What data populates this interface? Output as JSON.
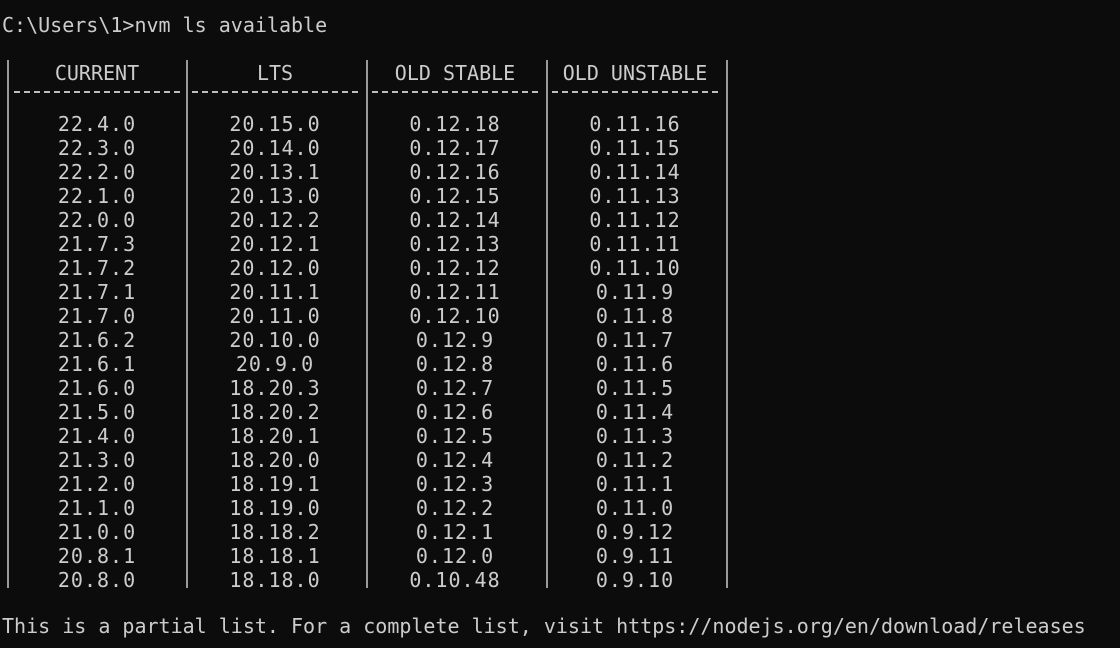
{
  "terminal": {
    "prompt": "C:\\Users\\1>nvm ls available",
    "footer": "This is a partial list. For a complete list, visit https://nodejs.org/en/download/releases"
  },
  "table": {
    "headers": [
      "CURRENT",
      "LTS",
      "OLD STABLE",
      "OLD UNSTABLE"
    ],
    "columns": {
      "current": [
        "22.4.0",
        "22.3.0",
        "22.2.0",
        "22.1.0",
        "22.0.0",
        "21.7.3",
        "21.7.2",
        "21.7.1",
        "21.7.0",
        "21.6.2",
        "21.6.1",
        "21.6.0",
        "21.5.0",
        "21.4.0",
        "21.3.0",
        "21.2.0",
        "21.1.0",
        "21.0.0",
        "20.8.1",
        "20.8.0"
      ],
      "lts": [
        "20.15.0",
        "20.14.0",
        "20.13.1",
        "20.13.0",
        "20.12.2",
        "20.12.1",
        "20.12.0",
        "20.11.1",
        "20.11.0",
        "20.10.0",
        "20.9.0",
        "18.20.3",
        "18.20.2",
        "18.20.1",
        "18.20.0",
        "18.19.1",
        "18.19.0",
        "18.18.2",
        "18.18.1",
        "18.18.0"
      ],
      "old_stable": [
        "0.12.18",
        "0.12.17",
        "0.12.16",
        "0.12.15",
        "0.12.14",
        "0.12.13",
        "0.12.12",
        "0.12.11",
        "0.12.10",
        "0.12.9",
        "0.12.8",
        "0.12.7",
        "0.12.6",
        "0.12.5",
        "0.12.4",
        "0.12.3",
        "0.12.2",
        "0.12.1",
        "0.12.0",
        "0.10.48"
      ],
      "old_unstable": [
        "0.11.16",
        "0.11.15",
        "0.11.14",
        "0.11.13",
        "0.11.12",
        "0.11.11",
        "0.11.10",
        "0.11.9",
        "0.11.8",
        "0.11.7",
        "0.11.6",
        "0.11.5",
        "0.11.4",
        "0.11.3",
        "0.11.2",
        "0.11.1",
        "0.11.0",
        "0.9.12",
        "0.9.11",
        "0.9.10"
      ]
    }
  },
  "colors": {
    "background": "#0c0c0c",
    "text": "#cccccc"
  }
}
